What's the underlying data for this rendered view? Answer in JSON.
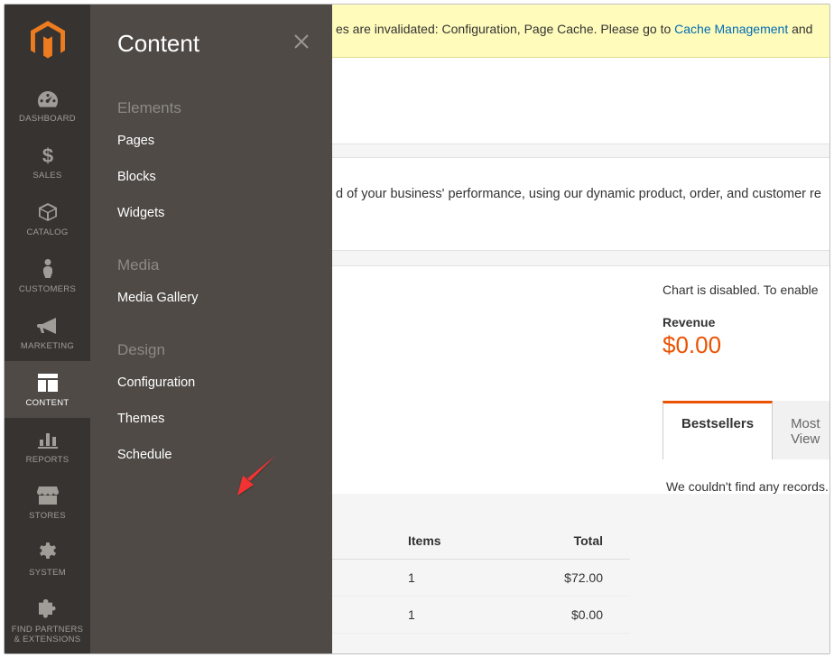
{
  "sidebar": {
    "items": [
      {
        "label": "DASHBOARD"
      },
      {
        "label": "SALES"
      },
      {
        "label": "CATALOG"
      },
      {
        "label": "CUSTOMERS"
      },
      {
        "label": "MARKETING"
      },
      {
        "label": "CONTENT"
      },
      {
        "label": "REPORTS"
      },
      {
        "label": "STORES"
      },
      {
        "label": "SYSTEM"
      },
      {
        "label": "FIND PARTNERS & EXTENSIONS"
      }
    ]
  },
  "flyout": {
    "title": "Content",
    "sections": {
      "elements": {
        "heading": "Elements",
        "items": [
          "Pages",
          "Blocks",
          "Widgets"
        ]
      },
      "media": {
        "heading": "Media",
        "items": [
          "Media Gallery"
        ]
      },
      "design": {
        "heading": "Design",
        "items": [
          "Configuration",
          "Themes",
          "Schedule"
        ]
      }
    }
  },
  "notice": {
    "prefix": "es are invalidated: Configuration, Page Cache. Please go to ",
    "link": "Cache Management",
    "suffix": " and "
  },
  "body": {
    "perf_text": "d of your business' performance, using our dynamic product, order, and customer re",
    "chart_note": "Chart is disabled. To enable ",
    "revenue_label": "Revenue",
    "revenue_value": "$0.00",
    "tabs": {
      "bestsellers": "Bestsellers",
      "mostview": "Most View"
    },
    "no_records": "We couldn't find any records."
  },
  "orders": {
    "cols": {
      "items": "Items",
      "total": "Total"
    },
    "rows": [
      {
        "items": "1",
        "total": "$72.00"
      },
      {
        "items": "1",
        "total": "$0.00"
      }
    ]
  }
}
